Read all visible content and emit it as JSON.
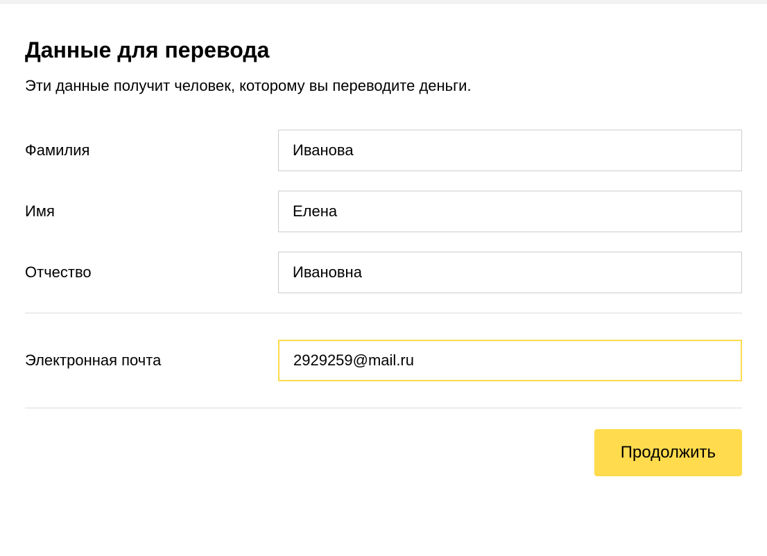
{
  "header": {
    "title": "Данные для перевода",
    "subtitle": "Эти данные получит человек, которому вы переводите деньги."
  },
  "form": {
    "surname": {
      "label": "Фамилия",
      "value": "Иванова"
    },
    "firstname": {
      "label": "Имя",
      "value": "Елена"
    },
    "patronymic": {
      "label": "Отчество",
      "value": "Ивановна"
    },
    "email": {
      "label": "Электронная почта",
      "value": "2929259@mail.ru"
    }
  },
  "actions": {
    "continue_label": "Продолжить"
  }
}
